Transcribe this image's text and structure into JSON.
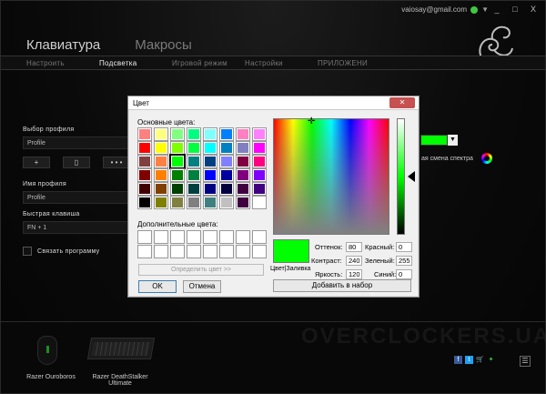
{
  "window": {
    "user_email": "vaiosay@gmail.com",
    "minimize": "_",
    "maximize": "□",
    "close": "X"
  },
  "nav": {
    "main": [
      "Клавиатура",
      "Макросы"
    ],
    "sub": [
      "Настроить",
      "Подсветка",
      "Игровой режим",
      "Настройки",
      "ПРИЛОЖЕНИ"
    ],
    "active_sub": "Подсветка"
  },
  "left_panel": {
    "profile_label": "Выбор профиля",
    "profile_value": "Profile",
    "add_btn": "+",
    "delete_btn": "▯",
    "more_btn": "• • •",
    "profile_name_label": "Имя профиля",
    "profile_name_value": "Profile",
    "hotkey_label": "Быстрая клавиша",
    "hotkey_value": "FN + 1",
    "link_program_label": "Связать программу"
  },
  "lighting": {
    "selected_color": "#00ff00",
    "spectrum_label": "ая смена спектра"
  },
  "devices": [
    {
      "name": "Razer Ouroboros"
    },
    {
      "name": "Razer DeathStalker Ultimate"
    }
  ],
  "watermark": "OVERCLOCKERS.UA",
  "social": {
    "facebook": "f",
    "twitter": "t",
    "cart": "🛒",
    "razer": "✦"
  },
  "menu_icon": "☰",
  "dialog": {
    "title": "Цвет",
    "close": "✕",
    "basic_colors_label": "Основные цвета:",
    "basic_colors": [
      "#ff8080",
      "#ffff80",
      "#80ff80",
      "#00ff80",
      "#80ffff",
      "#0080ff",
      "#ff80c0",
      "#ff80ff",
      "#ff0000",
      "#ffff00",
      "#80ff00",
      "#00ff40",
      "#00ffff",
      "#0080c0",
      "#8080c0",
      "#ff00ff",
      "#804040",
      "#ff8040",
      "#00ff00",
      "#008080",
      "#004080",
      "#8080ff",
      "#800040",
      "#ff0080",
      "#800000",
      "#ff8000",
      "#008000",
      "#008040",
      "#0000ff",
      "#0000a0",
      "#800080",
      "#8000ff",
      "#400000",
      "#804000",
      "#004000",
      "#004040",
      "#000080",
      "#000040",
      "#400040",
      "#400080",
      "#000000",
      "#808000",
      "#808040",
      "#808080",
      "#408080",
      "#c0c0c0",
      "#400040",
      "#ffffff"
    ],
    "selected_index": 18,
    "custom_colors_label": "Дополнительные цвета:",
    "define_btn": "Определить цвет >>",
    "ok_btn": "OK",
    "cancel_btn": "Отмена",
    "preview_label": "Цвет|Заливка",
    "hue_label": "Оттенок:",
    "hue": "80",
    "sat_label": "Контраст:",
    "sat": "240",
    "lum_label": "Яркость:",
    "lum": "120",
    "red_label": "Красный:",
    "red": "0",
    "green_label": "Зеленый:",
    "green": "255",
    "blue_label": "Синий:",
    "blue": "0",
    "add_btn": "Добавить в набор"
  }
}
